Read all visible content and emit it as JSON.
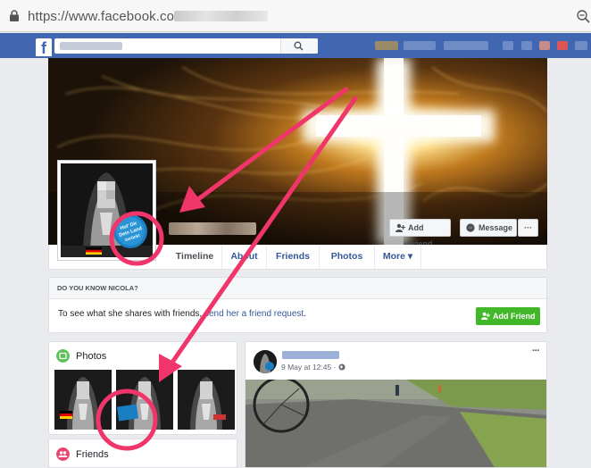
{
  "browser": {
    "url_prefix": "https://www.facebook.com/",
    "lock_icon": "lock-icon",
    "zoom_icon": "zoom-icon"
  },
  "fb_header": {
    "logo": "f",
    "search_icon": "search-icon"
  },
  "cover_buttons": {
    "add_friend": "Add Friend",
    "message": "Message",
    "more": "···"
  },
  "tabs": [
    "Timeline",
    "About",
    "Friends",
    "Photos",
    "More ▾"
  ],
  "badge": {
    "line1": "Hol' Dir",
    "line2": "Dein Land",
    "line3": "zurück!"
  },
  "know_card": {
    "heading": "DO YOU KNOW NICOLA?",
    "text_before": "To see what she shares with friends, ",
    "link": "send her a friend request",
    "text_after": ".",
    "button": "Add Friend"
  },
  "photos_card": {
    "title": "Photos"
  },
  "friends_card": {
    "title": "Friends"
  },
  "post": {
    "meta": "9 May at 12:45 · ",
    "menu": "···"
  },
  "colors": {
    "fb_blue": "#4267b2",
    "link_blue": "#365899",
    "green": "#42b72a",
    "annotation": "#f0356b"
  }
}
